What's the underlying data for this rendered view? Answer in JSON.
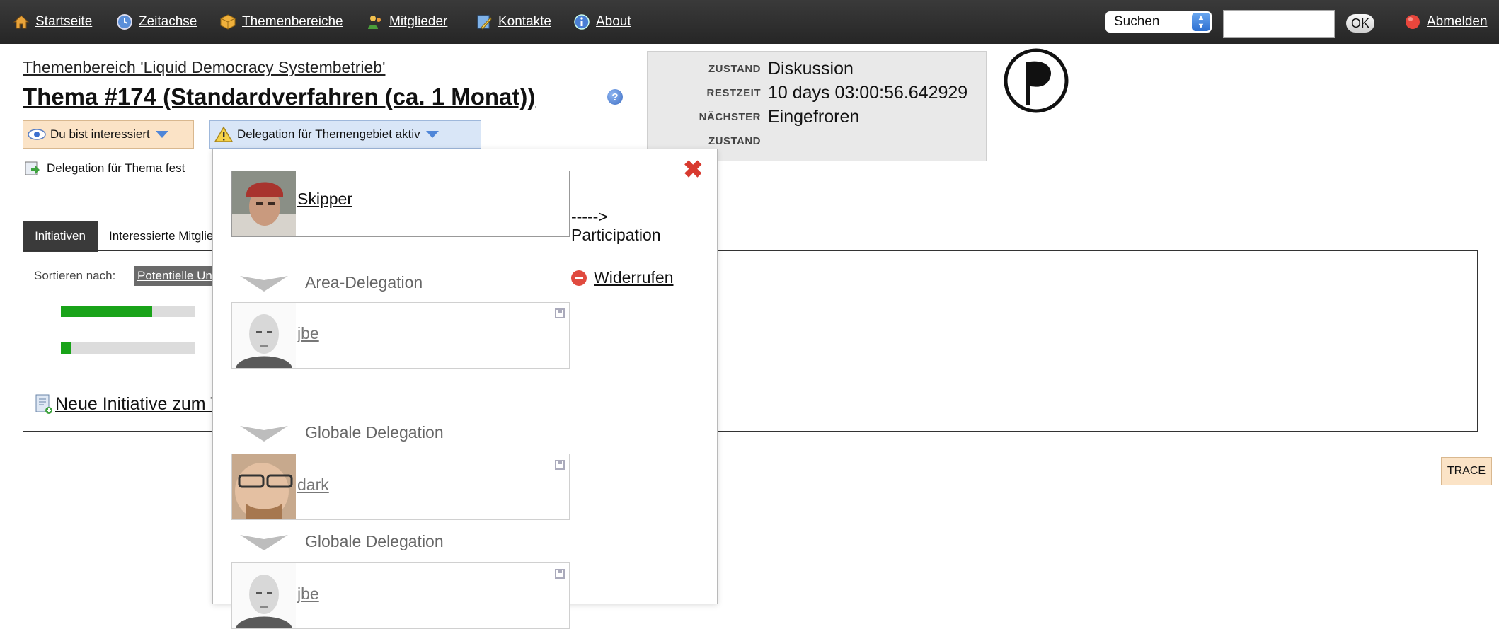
{
  "nav": {
    "home": "Startseite",
    "timeline": "Zeitachse",
    "areas": "Themenbereiche",
    "members": "Mitglieder",
    "contacts": "Kontakte",
    "about": "About",
    "search_select": "Suchen",
    "ok": "OK",
    "logout": "Abmelden"
  },
  "header": {
    "area_link": "Themenbereich 'Liquid Democracy Systembetrieb'",
    "title": "Thema #174 (Standardverfahren (ca. 1 Monat))",
    "interest_button": "Du bist interessiert",
    "delegation_button": "Delegation für Themengebiet aktiv",
    "set_delegation": "Delegation für Thema fest"
  },
  "state": {
    "label_state": "ZUSTAND",
    "value_state": "Diskussion",
    "label_remaining": "RESTZEIT",
    "value_remaining": "10 days 03:00:56.642929",
    "label_next": "NÄCHSTER",
    "value_next": "Eingefroren",
    "label_next2": "ZUSTAND"
  },
  "tabs": {
    "initiatives": "Initiativen",
    "interested": "Interessierte Mitglieder"
  },
  "content": {
    "sort_label": "Sortieren nach:",
    "sort_value": "Potentielle Unterstützer",
    "bars": [
      0.68,
      0.08
    ],
    "new_initiative": "Neue Initiative zum Thema hinzufügen",
    "trace": "TRACE"
  },
  "popup": {
    "user": "Skipper",
    "participation": "----->\nParticipation",
    "revoke": "Widerrufen",
    "chain": [
      {
        "type": "Area-Delegation",
        "user": "jbe"
      },
      {
        "type": "Globale Delegation",
        "user": "dark"
      },
      {
        "type": "Globale Delegation",
        "user": "jbe"
      }
    ]
  },
  "colors": {
    "topbar": "#2e2e2e",
    "interest_bg": "#fbe3c6",
    "delegation_bg": "#d9e6f7",
    "bar_fill": "#19a319",
    "close": "#d83a2f"
  }
}
